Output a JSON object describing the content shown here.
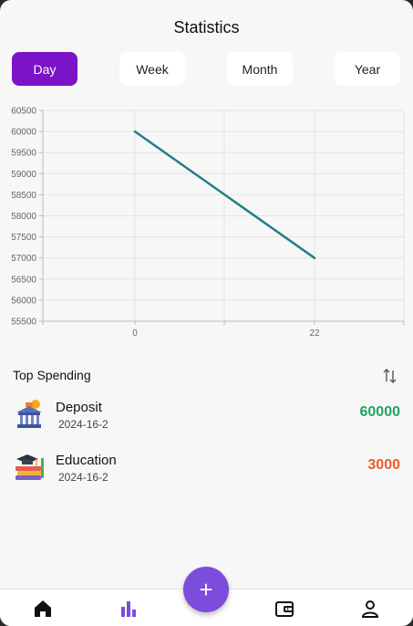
{
  "header": {
    "title": "Statistics"
  },
  "tabs": [
    {
      "label": "Day",
      "active": true
    },
    {
      "label": "Week",
      "active": false
    },
    {
      "label": "Month",
      "active": false
    },
    {
      "label": "Year",
      "active": false
    }
  ],
  "chart_data": {
    "type": "line",
    "x_ticks": [
      "0",
      "22"
    ],
    "y_ticks": [
      "60500",
      "60000",
      "59500",
      "59000",
      "58500",
      "58000",
      "57500",
      "57000",
      "56500",
      "56000",
      "55500"
    ],
    "ylim": [
      55500,
      60500
    ],
    "series": [
      {
        "x": [
          0,
          22
        ],
        "values": [
          60000,
          57000
        ],
        "color": "#1f7f86"
      }
    ],
    "grid": true
  },
  "top_spending": {
    "title": "Top Spending",
    "sort_icon": "sort-arrows-icon",
    "items": [
      {
        "name": "Deposit",
        "date": "2024-16-2",
        "amount": "60000",
        "color": "#21a366",
        "icon": "bank-icon"
      },
      {
        "name": "Education",
        "date": "2024-16-2",
        "amount": "3000",
        "color": "#f05a28",
        "icon": "books-icon"
      }
    ]
  },
  "bottom_nav": {
    "items": [
      "home-icon",
      "bar-chart-icon",
      "wallet-icon",
      "profile-icon"
    ],
    "fab_label": "+",
    "active_color": "#7c4ddc"
  }
}
